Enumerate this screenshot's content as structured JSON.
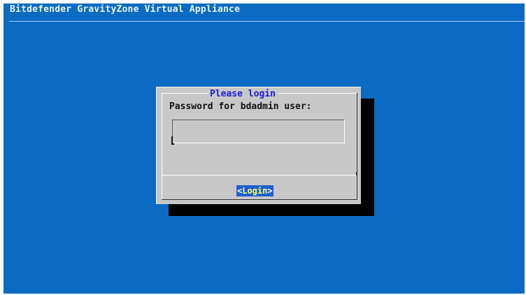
{
  "app": {
    "title": "Bitdefender GravityZone Virtual Appliance"
  },
  "dialog": {
    "title": "Please login",
    "prompt": "Password for bdadmin user:",
    "password_value": "",
    "login_left_bracket": "<",
    "login_label": "Login",
    "login_right_bracket": ">"
  },
  "colors": {
    "background": "#0b6bc3",
    "dialog": "#c8c8c8",
    "dialog_title": "#1b1bd6",
    "button_bg": "#1e5fd0",
    "button_text": "#ffff66"
  }
}
